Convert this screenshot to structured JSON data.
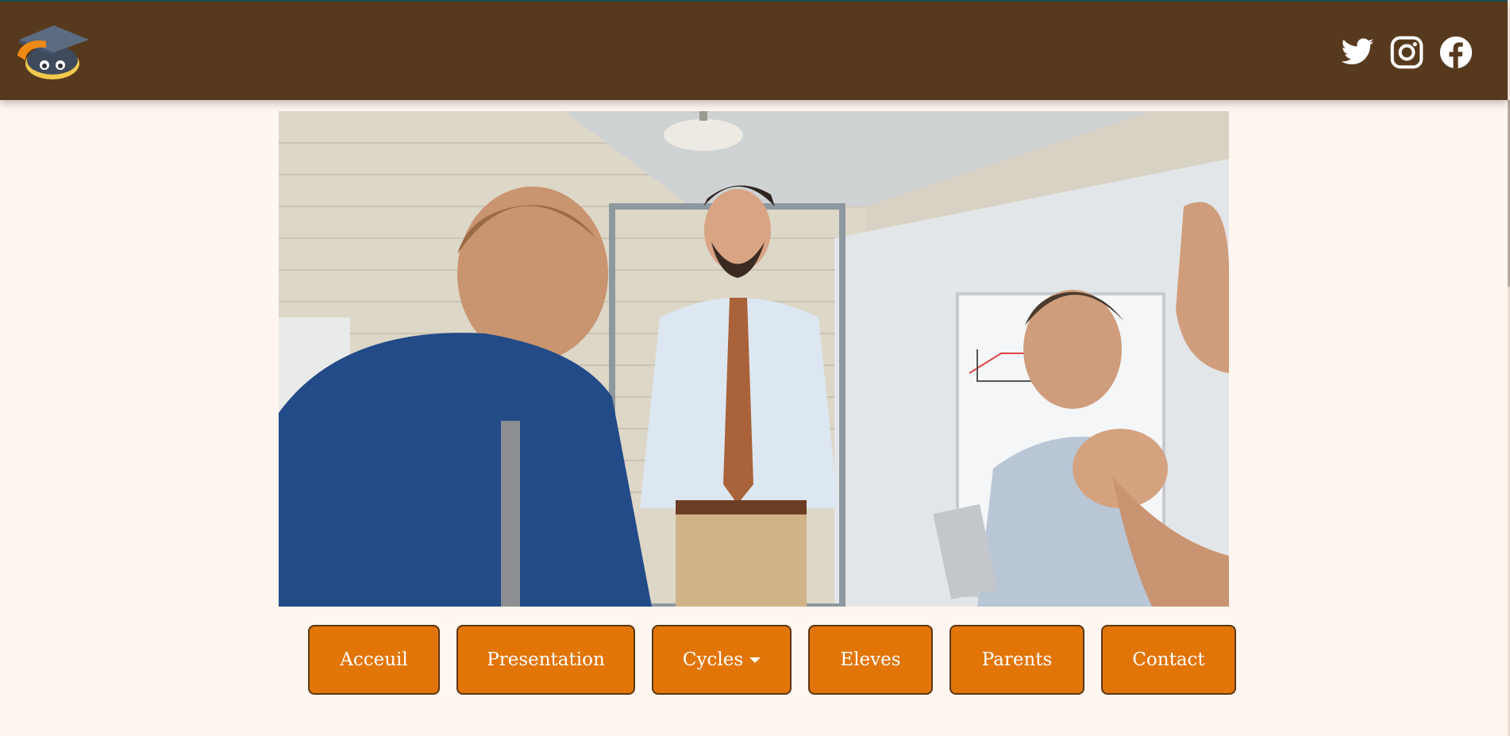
{
  "header": {
    "logo_icon": "graduation-cap-mascot-icon",
    "social": [
      {
        "name": "twitter",
        "icon": "twitter-icon"
      },
      {
        "name": "instagram",
        "icon": "instagram-icon"
      },
      {
        "name": "facebook",
        "icon": "facebook-icon"
      }
    ]
  },
  "hero": {
    "image": "classroom-meeting-photo"
  },
  "nav": {
    "items": [
      {
        "label": "Acceuil"
      },
      {
        "label": "Presentation"
      },
      {
        "label": "Cycles",
        "dropdown": true
      },
      {
        "label": "Eleves"
      },
      {
        "label": "Parents"
      },
      {
        "label": "Contact"
      }
    ]
  },
  "colors": {
    "header_bg": "#573a1e",
    "page_bg": "#fff6ef",
    "button_bg": "#e27508",
    "button_border": "#5a3715",
    "button_text": "#ffffff"
  }
}
